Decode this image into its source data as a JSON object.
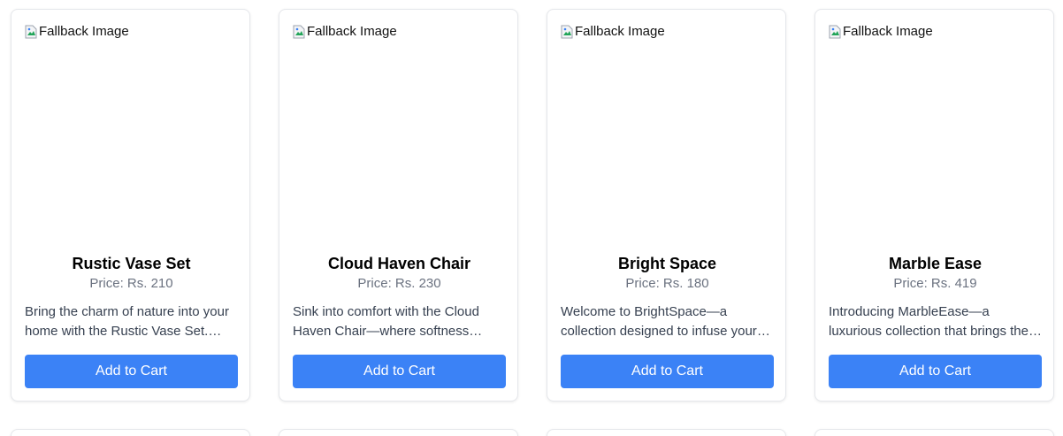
{
  "image_alt": "Fallback Image",
  "accent_color": "#3b82f6",
  "products": [
    {
      "name": "Rustic Vase Set",
      "price": "Price: Rs. 210",
      "description": "Bring the charm of nature into your home with the Rustic Vase Set. Each piece is handcrafted to add warmth to any room.",
      "button_label": "Add to Cart"
    },
    {
      "name": "Cloud Haven Chair",
      "price": "Price: Rs. 230",
      "description": "Sink into comfort with the Cloud Haven Chair—where softness meets modern style for your living space.",
      "button_label": "Add to Cart"
    },
    {
      "name": "Bright Space",
      "price": "Price: Rs. 180",
      "description": "Welcome to BrightSpace—a collection designed to infuse your home with light, color and energy.",
      "button_label": "Add to Cart"
    },
    {
      "name": "Marble Ease",
      "price": "Price: Rs. 419",
      "description": "Introducing MarbleEase—a luxurious collection that brings the elegance of marble to your everyday life.",
      "button_label": "Add to Cart"
    }
  ]
}
